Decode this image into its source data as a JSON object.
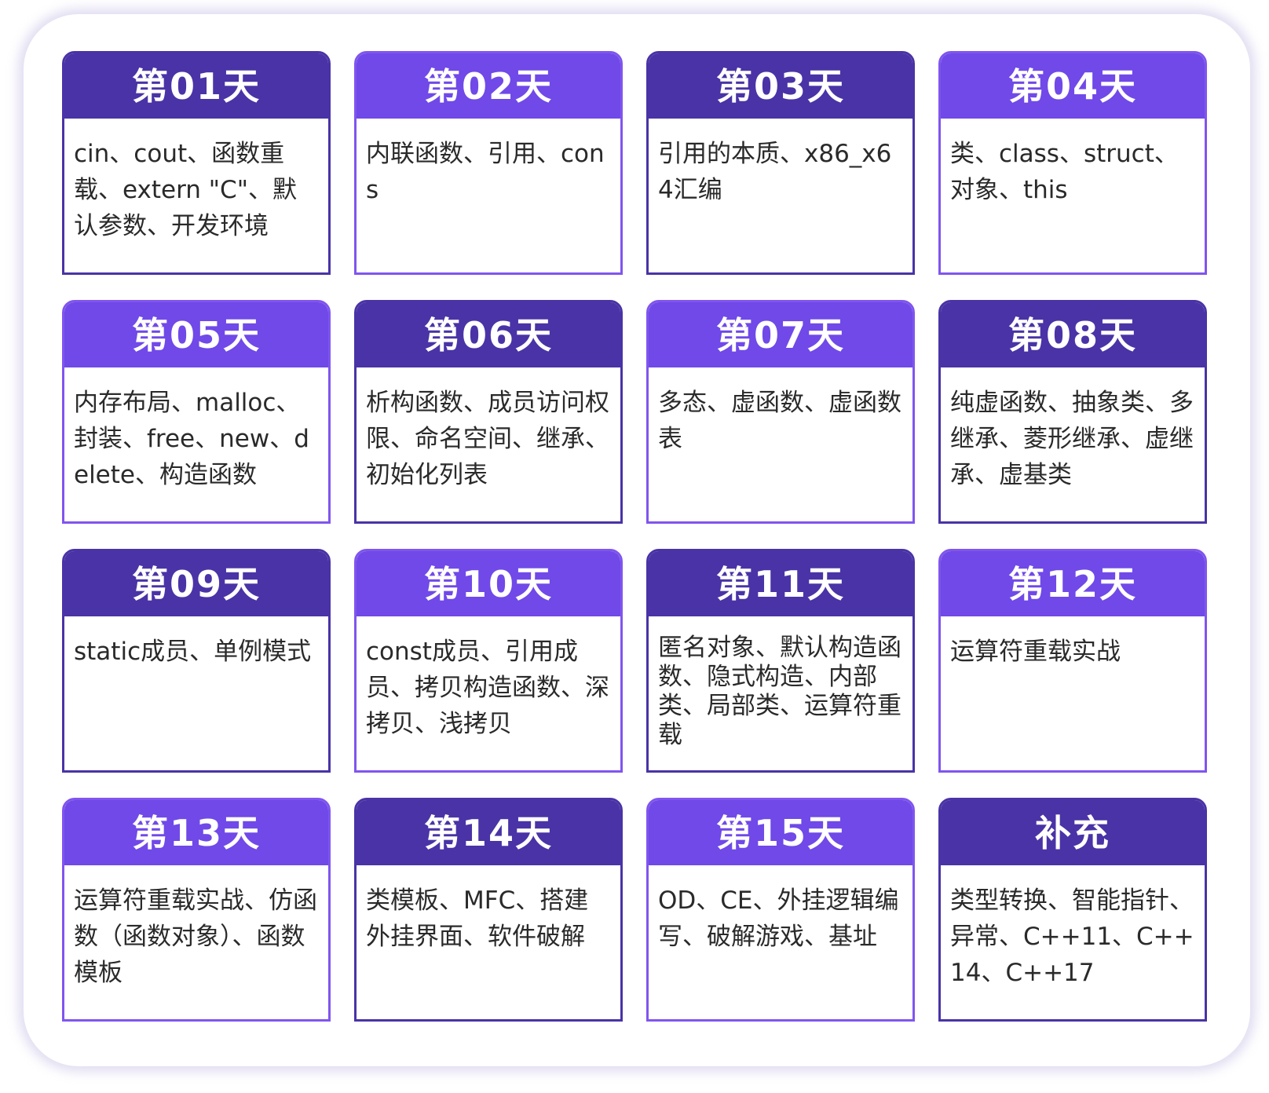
{
  "cards": [
    {
      "title": "第01天",
      "body": "cin、cout、函数重载、extern \"C\"、默认参数、开发环境"
    },
    {
      "title": "第02天",
      "body": "内联函数、引用、cons"
    },
    {
      "title": "第03天",
      "body": "引用的本质、x86_x64汇编"
    },
    {
      "title": "第04天",
      "body": "类、class、struct、对象、this"
    },
    {
      "title": "第05天",
      "body": "内存布局、malloc、封装、free、new、delete、构造函数"
    },
    {
      "title": "第06天",
      "body": "析构函数、成员访问权限、命名空间、继承、初始化列表"
    },
    {
      "title": "第07天",
      "body": "多态、虚函数、虚函数表"
    },
    {
      "title": "第08天",
      "body": "纯虚函数、抽象类、多继承、菱形继承、虚继承、虚基类"
    },
    {
      "title": "第09天",
      "body": "static成员、单例模式"
    },
    {
      "title": "第10天",
      "body": "const成员、引用成员、拷贝构造函数、深拷贝、浅拷贝"
    },
    {
      "title": "第11天",
      "body": "匿名对象、默认构造函数、隐式构造、内部类、局部类、运算符重载"
    },
    {
      "title": "第12天",
      "body": "运算符重载实战"
    },
    {
      "title": "第13天",
      "body": "运算符重载实战、仿函数（函数对象）、函数模板"
    },
    {
      "title": "第14天",
      "body": "类模板、MFC、搭建外挂界面、软件破解"
    },
    {
      "title": "第15天",
      "body": "OD、CE、外挂逻辑编写、破解游戏、基址"
    },
    {
      "title": "补充",
      "body": "类型转换、智能指针、异常、C++11、C++14、C++17"
    }
  ]
}
